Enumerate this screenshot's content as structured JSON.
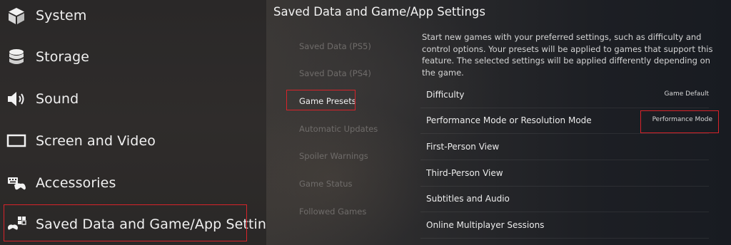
{
  "sidebar": {
    "items": [
      {
        "label": "System",
        "icon": "cube-icon"
      },
      {
        "label": "Storage",
        "icon": "storage-icon"
      },
      {
        "label": "Sound",
        "icon": "speaker-icon"
      },
      {
        "label": "Screen and Video",
        "icon": "screen-icon"
      },
      {
        "label": "Accessories",
        "icon": "accessories-icon"
      },
      {
        "label": "Saved Data and Game/App Settings",
        "icon": "saved-data-icon"
      }
    ],
    "selected": "Saved Data and Game/App Settings"
  },
  "panel": {
    "title": "Saved Data and Game/App Settings",
    "sub_nav": [
      "Saved Data (PS5)",
      "Saved Data (PS4)",
      "Game Presets",
      "Automatic Updates",
      "Spoiler Warnings",
      "Game Status",
      "Followed Games"
    ],
    "active_sub_nav": "Game Presets",
    "description": "Start new games with your preferred settings, such as difficulty and control options. Your presets will be applied to games that support this feature. The selected settings will be applied differently depending on the game.",
    "settings": [
      {
        "label": "Difficulty",
        "value": "Game Default"
      },
      {
        "label": "Performance Mode or Resolution Mode",
        "value": "Performance Mode"
      },
      {
        "label": "First-Person View",
        "value": ""
      },
      {
        "label": "Third-Person View",
        "value": ""
      },
      {
        "label": "Subtitles and Audio",
        "value": ""
      },
      {
        "label": "Online Multiplayer Sessions",
        "value": ""
      }
    ]
  },
  "colors": {
    "highlight": "#d8232a",
    "inactive_text": "#6f6c6a"
  }
}
